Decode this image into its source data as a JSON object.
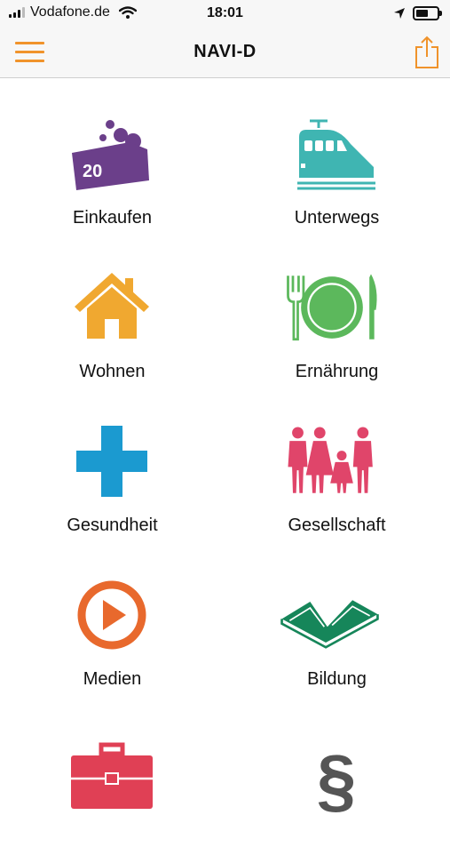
{
  "status_bar": {
    "carrier": "Vodafone.de",
    "time": "18:01",
    "battery_level": 0.6
  },
  "nav": {
    "title": "NAVI-D",
    "menu_icon": "hamburger-icon",
    "share_icon": "share-icon"
  },
  "colors": {
    "accent": "#f0932b"
  },
  "categories": [
    {
      "label": "Einkaufen",
      "icon": "price-tag-icon",
      "icon_text": "20",
      "color": "#6b3f8a"
    },
    {
      "label": "Unterwegs",
      "icon": "train-icon",
      "color": "#3fb5b2"
    },
    {
      "label": "Wohnen",
      "icon": "house-icon",
      "color": "#f0a830"
    },
    {
      "label": "Ernährung",
      "icon": "plate-cutlery-icon",
      "color": "#5cb85c"
    },
    {
      "label": "Gesundheit",
      "icon": "medical-cross-icon",
      "color": "#1b9ad0"
    },
    {
      "label": "Gesellschaft",
      "icon": "family-icon",
      "color": "#e0456a"
    },
    {
      "label": "Medien",
      "icon": "play-icon",
      "color": "#e8692d"
    },
    {
      "label": "Bildung",
      "icon": "open-book-icon",
      "color": "#16865a"
    },
    {
      "label": "",
      "icon": "briefcase-icon",
      "color": "#e04055"
    },
    {
      "label": "",
      "icon": "paragraph-icon",
      "color": "#555555"
    }
  ]
}
